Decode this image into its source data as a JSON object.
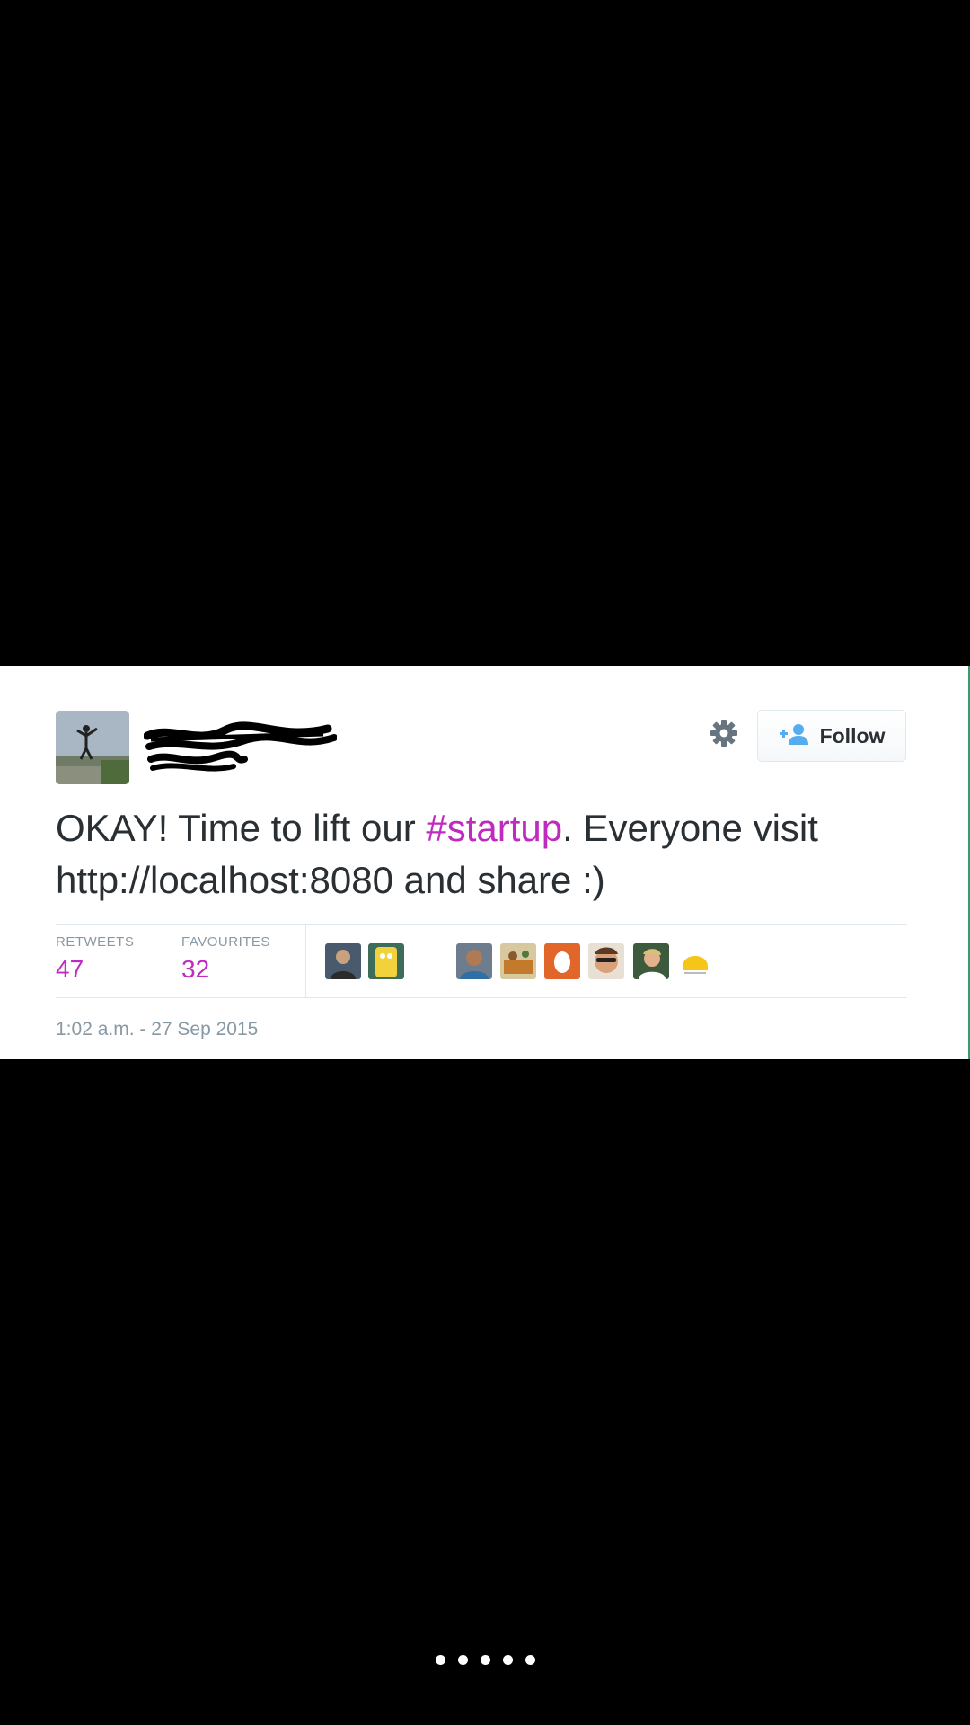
{
  "tweet": {
    "text_before": "OKAY! Time to lift our ",
    "hashtag": "#startup",
    "text_after": ". Everyone visit http://localhost:8080 and share :)",
    "follow_label": "Follow",
    "retweets_label": "RETWEETS",
    "retweets_count": "47",
    "favourites_label": "FAVOURITES",
    "favourites_count": "32",
    "timestamp": "1:02 a.m. - 27 Sep 2015",
    "accent_color": "#c02bbf",
    "favouriter_avatars": 10
  },
  "pager": {
    "dot_count": 5
  },
  "icons": {
    "settings": "gear-icon",
    "follow": "add-user-icon"
  }
}
